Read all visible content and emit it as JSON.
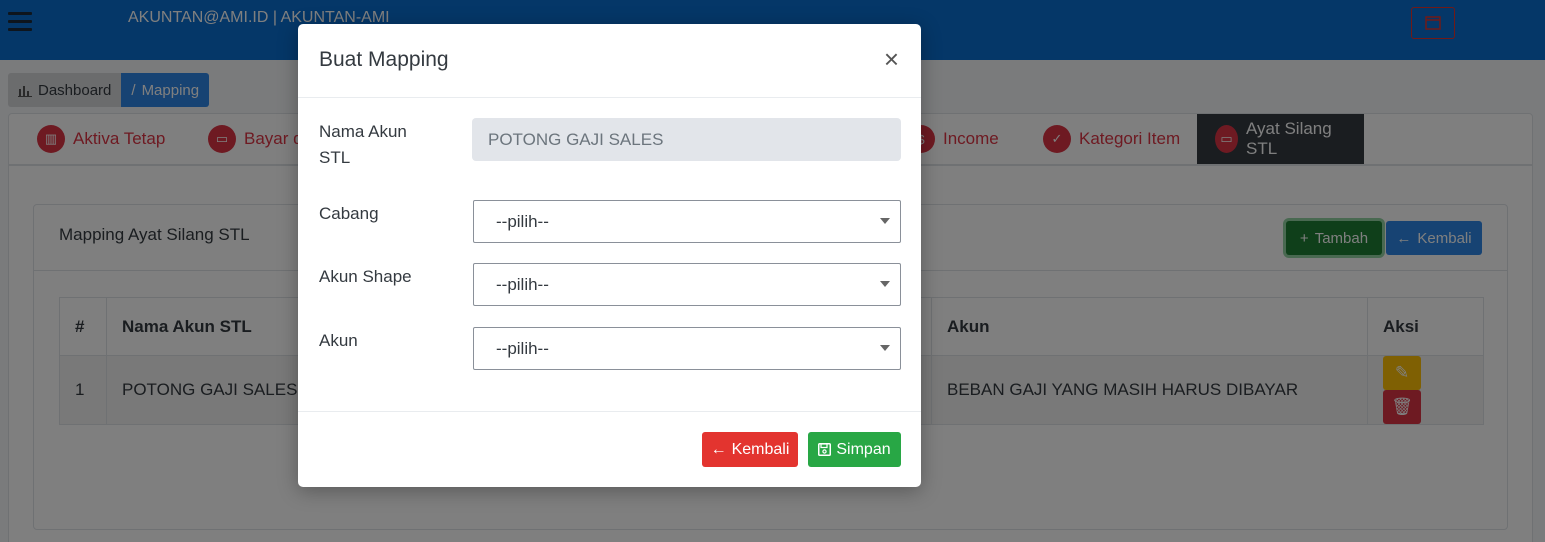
{
  "navbar": {
    "user_text": "AKUNTAN@AMI.ID | AKUNTAN-AMI"
  },
  "breadcrumb": {
    "home": "Dashboard",
    "current": "Mapping"
  },
  "tabs": [
    {
      "label": "Aktiva Tetap",
      "active": false
    },
    {
      "label": "Bayar di",
      "active": false
    },
    {
      "label": "Income",
      "active": false
    },
    {
      "label": "Kategori Item",
      "active": false
    },
    {
      "label": "Ayat Silang STL",
      "active": true
    }
  ],
  "panel": {
    "title": "Mapping Ayat Silang STL",
    "add_label": "Tambah",
    "back_label": "Kembali"
  },
  "table": {
    "headers": {
      "no": "#",
      "nama": "Nama Akun STL",
      "akun": "Akun",
      "aksi": "Aksi"
    },
    "rows": [
      {
        "no": "1",
        "nama": "POTONG GAJI SALES",
        "akun": "BEBAN GAJI YANG MASIH HARUS DIBAYAR"
      }
    ]
  },
  "modal": {
    "title": "Buat Mapping",
    "close": "×",
    "nama_akun_label_1": "Nama Akun",
    "nama_akun_label_2": "STL",
    "nama_akun_value": "POTONG GAJI SALES",
    "cabang_label": "Cabang",
    "cabang_value": "--pilih--",
    "akun_shape_label": "Akun Shape",
    "akun_shape_value": "--pilih--",
    "akun_label": "Akun",
    "akun_value": "--pilih--",
    "back_label": "Kembali",
    "save_label": "Simpan"
  },
  "colors": {
    "navbar": "#0a6ed1",
    "danger": "#dc3545",
    "success": "#28a745",
    "primary": "#2f86e6",
    "warning": "#ffc107"
  }
}
